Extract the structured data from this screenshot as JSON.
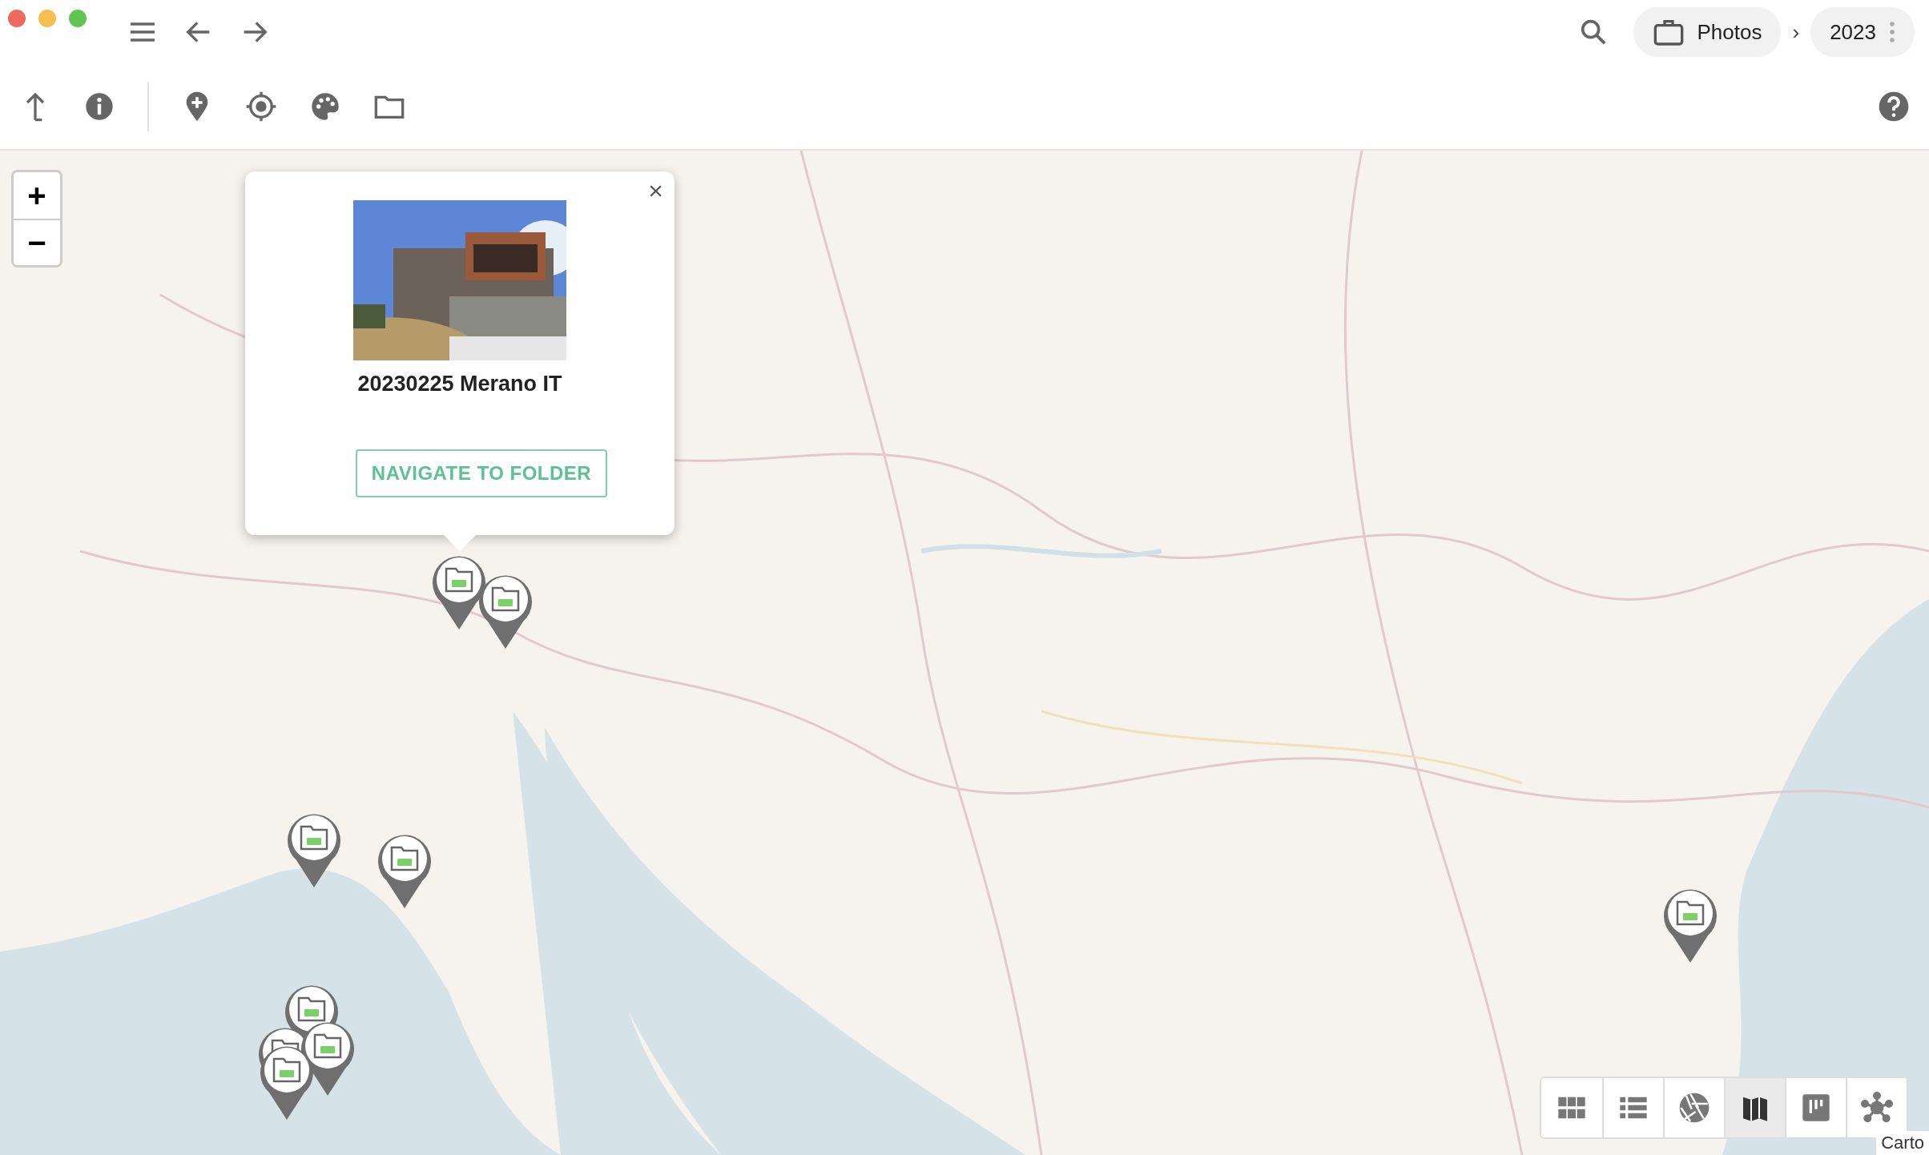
{
  "breadcrumbs": [
    {
      "label": "Photos",
      "kind": "album"
    },
    {
      "label": "2023",
      "kind": "year"
    }
  ],
  "breadcrumb_separator": "›",
  "map": {
    "zoom_in": "+",
    "zoom_out": "−",
    "attribution": "Carto"
  },
  "popup": {
    "close": "×",
    "title": "20230225 Merano IT",
    "button": "NAVIGATE TO FOLDER"
  },
  "view_modes": [
    {
      "kind": "grid",
      "selected": false
    },
    {
      "kind": "list",
      "selected": false
    },
    {
      "kind": "aperture",
      "selected": false
    },
    {
      "kind": "map",
      "selected": true
    },
    {
      "kind": "board",
      "selected": false
    },
    {
      "kind": "graph",
      "selected": false
    }
  ]
}
